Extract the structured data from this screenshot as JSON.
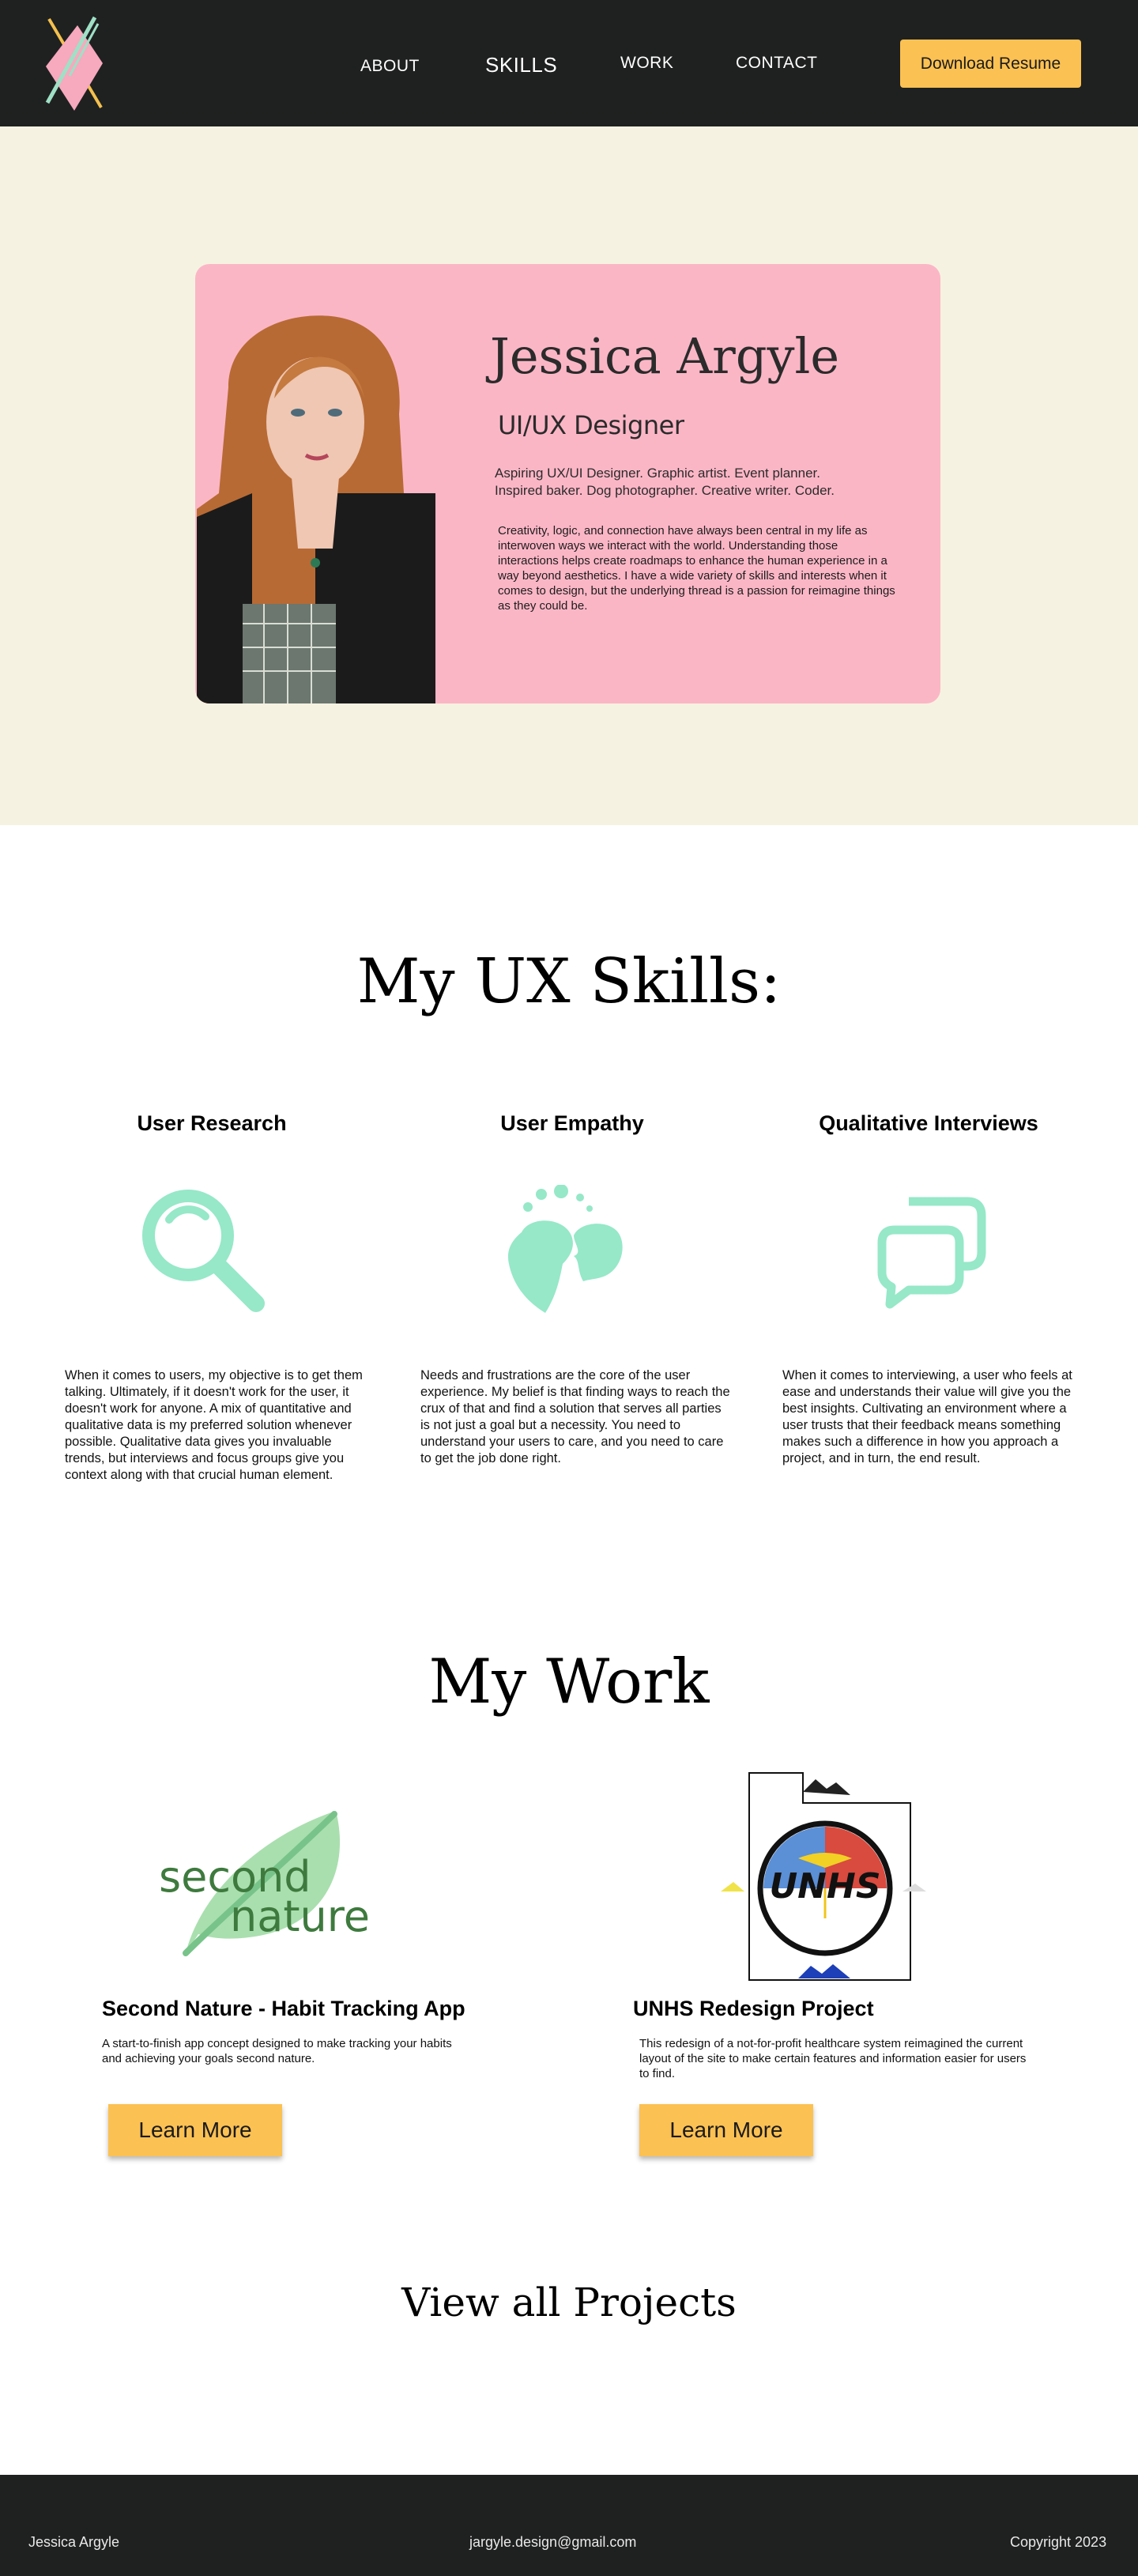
{
  "nav": {
    "logo": "jessica-argyle-logo",
    "about": "ABOUT",
    "skills": "SKILLS",
    "work": "WORK",
    "contact": "CONTACT",
    "resume_button": "Download Resume"
  },
  "hero": {
    "name": "Jessica Argyle",
    "role": "UI/UX Designer",
    "tagline_line1": "Aspiring UX/UI Designer. Graphic artist. Event planner.",
    "tagline_line2": "Inspired baker. Dog photographer. Creative writer. Coder.",
    "bio": "Creativity, logic, and connection have always been central in my life as interwoven ways we interact with the world. Understanding those interactions helps create roadmaps to enhance the human experience in a way beyond aesthetics. I have a wide variety of skills and interests when it comes to design, but the underlying thread is a passion for reimagine things as they could be."
  },
  "skills": {
    "title": "My UX Skills:",
    "items": [
      {
        "name": "User Research",
        "icon": "magnifying-glass-icon",
        "text": "When it comes to users, my objective is to get them talking. Ultimately, if it doesn't work for the user, it doesn't work for anyone. A mix of quantitative and qualitative data is my preferred solution whenever possible. Qualitative data gives you invaluable trends, but interviews and focus groups give you context along with that crucial human element."
      },
      {
        "name": "User Empathy",
        "icon": "two-heads-icon",
        "text": "Needs and frustrations are the core of the user experience. My belief is that finding ways to reach the crux of that and find a solution that serves all parties is not just a goal but a necessity. You need to understand your users to care, and you need to care to get the job done right."
      },
      {
        "name": "Qualitative Interviews",
        "icon": "chat-bubbles-icon",
        "text": "When it comes to interviewing, a user who feels at ease and understands their value will give you the best insights. Cultivating an environment where a user trusts that their feedback means something makes such a difference in how you approach a project, and in turn, the end result."
      }
    ],
    "accent_color": "#96e8c8"
  },
  "work": {
    "title": "My Work",
    "projects": [
      {
        "logo_word1": "second",
        "logo_word2": "nature",
        "title": "Second Nature - Habit Tracking App",
        "description": "A start-to-finish app concept designed to make tracking your habits and achieving your goals second nature.",
        "button": "Learn More"
      },
      {
        "logo_word": "UNHS",
        "title": "UNHS Redesign Project",
        "description": "This redesign of a not-for-profit healthcare system reimagined the current layout of the site to make certain features and information easier for users to find.",
        "button": "Learn More"
      }
    ],
    "view_all": "View all Projects"
  },
  "footer": {
    "name": "Jessica Argyle",
    "email": "jargyle.design@gmail.com",
    "copyright": "Copyright 2023"
  },
  "colors": {
    "dark": "#1f2120",
    "cream": "#f6f2e1",
    "pink": "#fbb6c6",
    "gold": "#fcc153",
    "mint": "#96e8c8"
  }
}
